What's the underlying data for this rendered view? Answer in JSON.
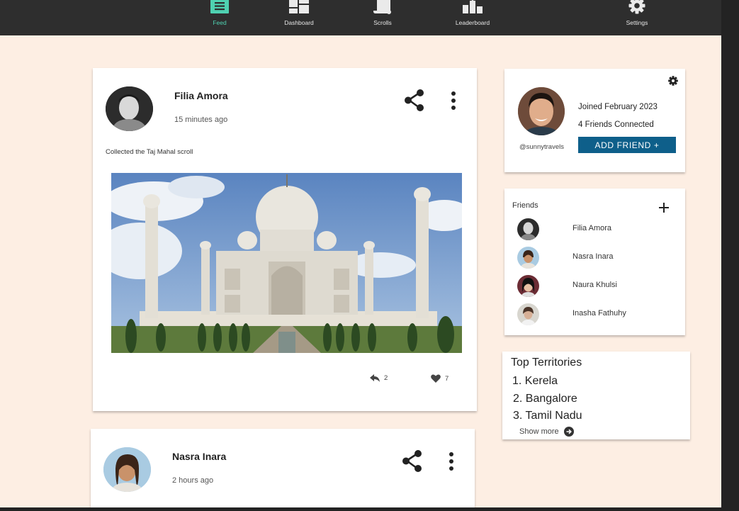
{
  "nav": {
    "items": [
      {
        "label": "Feed",
        "icon": "feed-icon",
        "active": true
      },
      {
        "label": "Dashboard",
        "icon": "dashboard-icon"
      },
      {
        "label": "Scrolls",
        "icon": "scroll-icon"
      },
      {
        "label": "Leaderboard",
        "icon": "leaderboard-icon"
      },
      {
        "label": "Settings",
        "icon": "gear-icon"
      }
    ],
    "active_color": "#4fd1b1",
    "background": "#2e2e2e"
  },
  "page_background": "#fdeee3",
  "feed": {
    "posts": [
      {
        "author": "Filia Amora",
        "time": "15 minutes ago",
        "caption": "Collected the Taj Mahal scroll",
        "image": "taj-mahal-photo",
        "replies": "2",
        "likes": "7"
      },
      {
        "author": "Nasra Inara",
        "time": "2 hours ago"
      }
    ]
  },
  "profile": {
    "joined": "Joined February 2023",
    "friends_connected": "4 Friends Connected",
    "handle": "@sunnytravels",
    "add_friend_label": "ADD FRIEND +",
    "button_color": "#0e5f8a"
  },
  "friends": {
    "title": "Friends",
    "list": [
      {
        "name": "Filia Amora"
      },
      {
        "name": "Nasra Inara"
      },
      {
        "name": "Naura Khulsi"
      },
      {
        "name": "Inasha Fathuhy"
      }
    ]
  },
  "territories": {
    "title": "Top Territories",
    "items": [
      "1. Kerela",
      "2. Bangalore",
      "3. Tamil Nadu"
    ],
    "show_more": "Show more"
  }
}
